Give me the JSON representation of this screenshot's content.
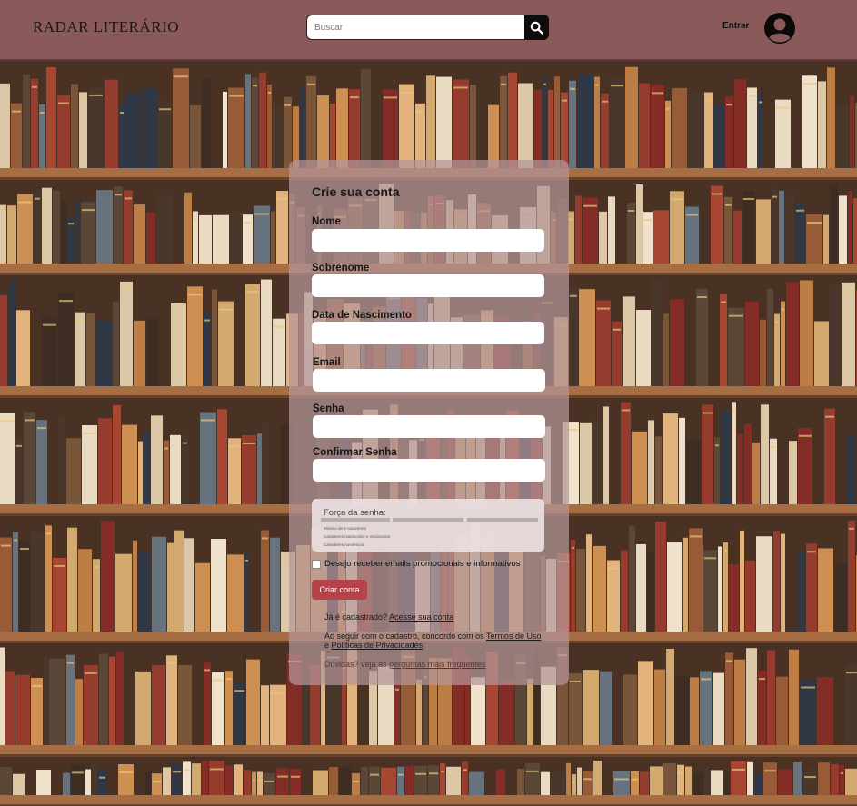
{
  "header": {
    "logo": "RADAR LITERÁRIO",
    "search_placeholder": "Buscar",
    "login_label": "Entrar"
  },
  "icons": {
    "search": "search-icon",
    "avatar": "user-avatar-icon"
  },
  "form": {
    "title": "Crie sua conta",
    "fields": {
      "first_name": "Nome",
      "last_name": "Sobrenome",
      "birth_date": "Data de Nascimento",
      "email": "Email",
      "password": "Senha",
      "confirm_password": "Confirmar Senha"
    },
    "strength": {
      "title": "Força da senha:",
      "requirements": [
        "Mínimo de 8 caracteres",
        "Caracteres maiúsculos e minúsculos",
        "Caracteres numéricos"
      ]
    },
    "newsletter_label": "Desejo receber emails promocionais e informativos",
    "submit_label": "Criar conta",
    "already_text": "Já é cadastrado?",
    "already_link": "Acesse sua conta",
    "terms_text": "Ao seguir com o cadastro, concordo com os",
    "terms_link": "Termos de Uso",
    "terms_and": "e",
    "privacy_link": "Políticas de Privacidades",
    "faq_text": "Dúvidas? veja as",
    "faq_link": "perguntas mais frequentes"
  },
  "colors": {
    "header_bg": "#8a5a5b",
    "panel_bg": "#b49698",
    "button_bg": "#b7434a",
    "shelf_wood": "#a0643a"
  }
}
